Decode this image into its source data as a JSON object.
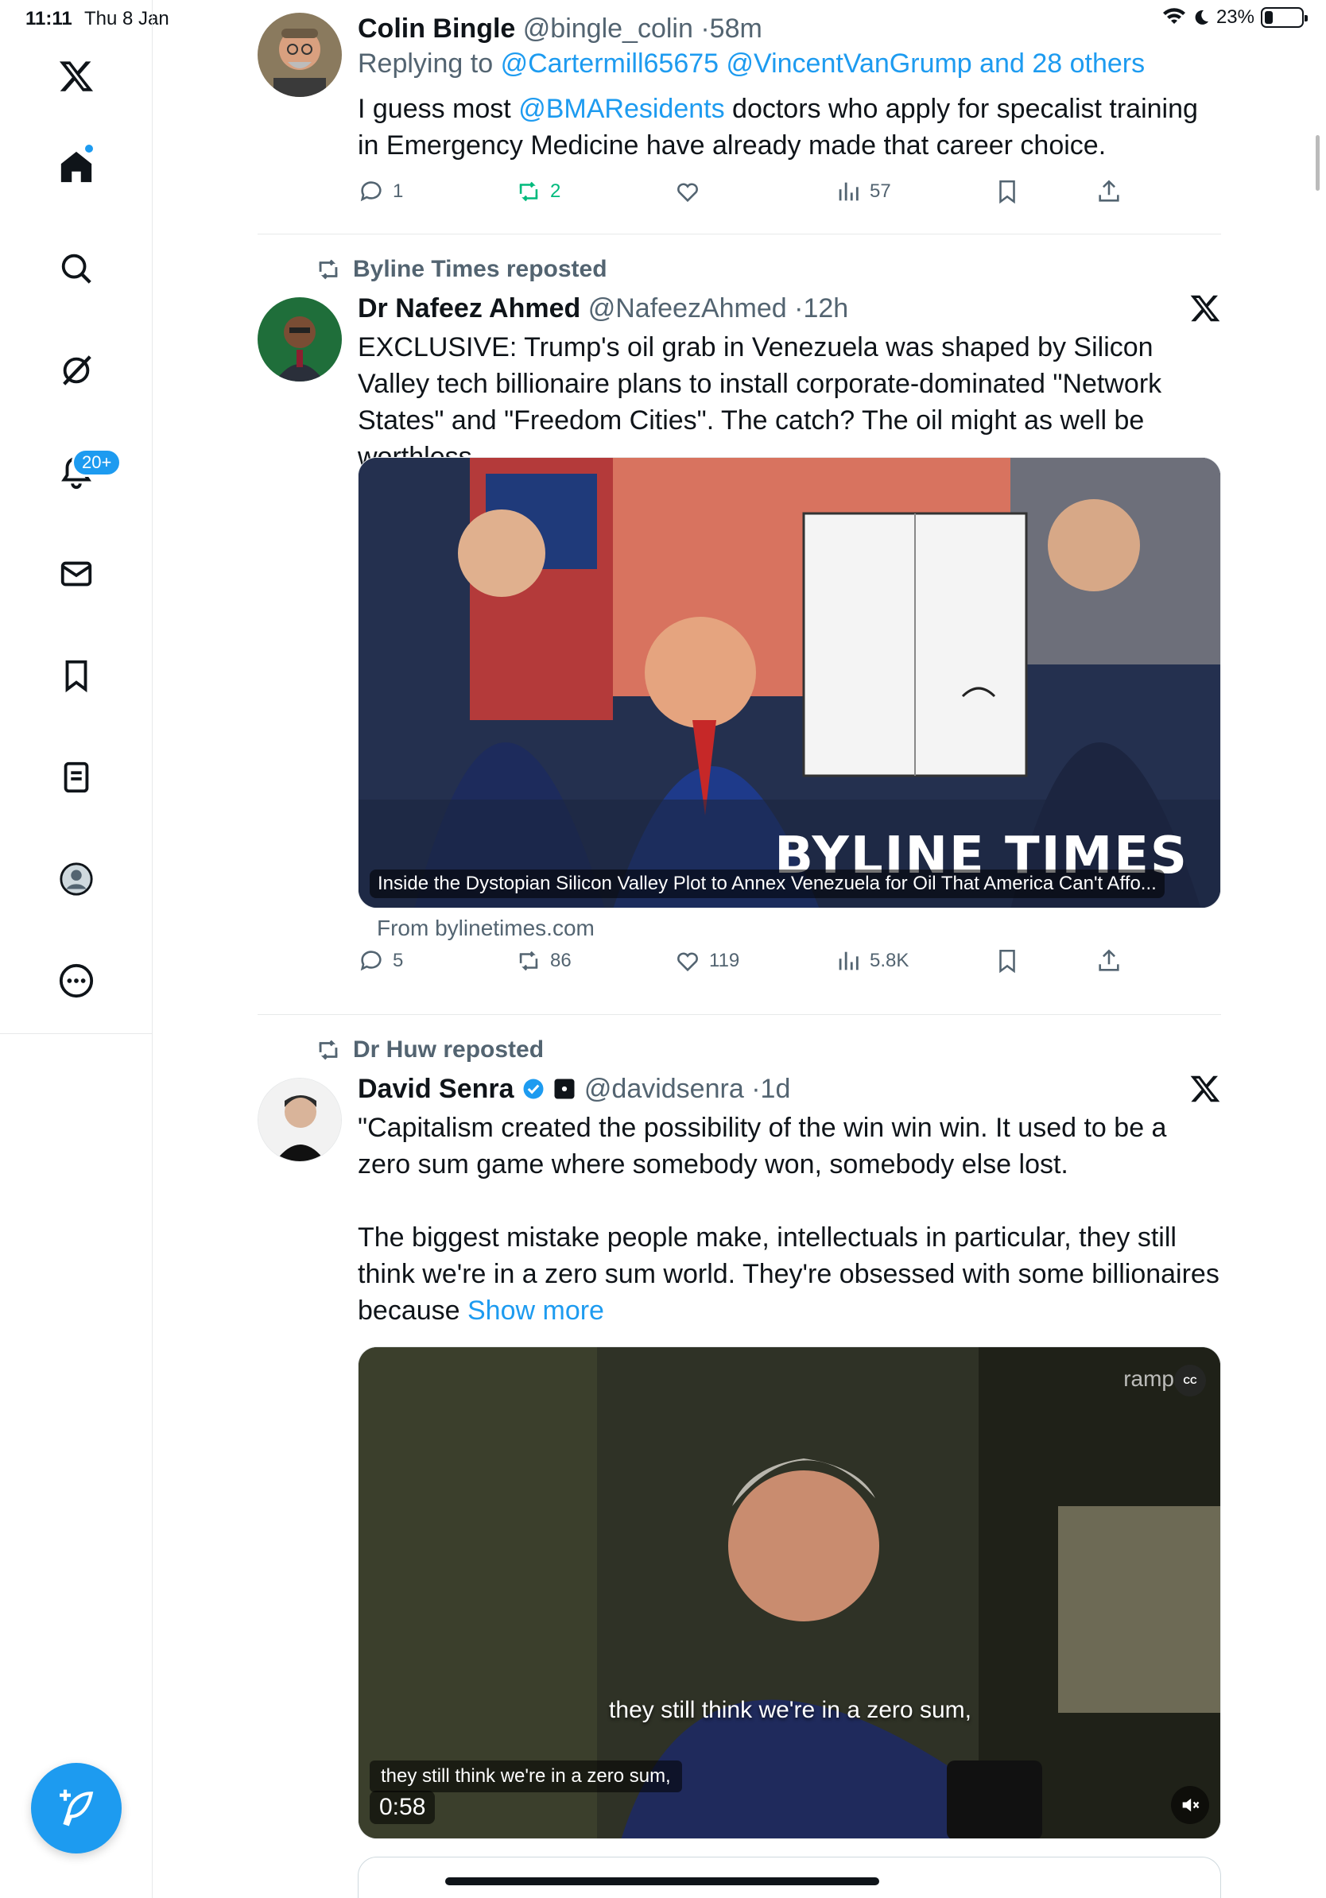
{
  "status_bar": {
    "time": "11:11",
    "date": "Thu 8 Jan",
    "battery": "23%"
  },
  "sidebar": {
    "notifications_badge": "20+"
  },
  "tweets": [
    {
      "name": "Colin Bingle",
      "handle": "@bingle_colin",
      "time": "58m",
      "replying_prefix": "Replying to",
      "replying_to": "@Cartermill65675 @VincentVanGrump and 28 others",
      "text_pre": "I guess most",
      "text_mention": "@BMAResidents",
      "text_post": "doctors who apply for  specalist training in Emergency Medicine have already made that career choice.",
      "replies": "1",
      "reposts": "2",
      "likes": "",
      "views": "57"
    },
    {
      "reposted_by": "Byline Times reposted",
      "name": "Dr Nafeez Ahmed",
      "handle": "@NafeezAhmed",
      "time": "12h",
      "text": "EXCLUSIVE: Trump's oil grab in Venezuela was shaped by Silicon Valley tech billionaire plans to install corporate-dominated \"Network States\" and \"Freedom Cities\". The catch? The oil might as well be worthless.",
      "card_caption": "Inside the Dystopian Silicon Valley Plot to Annex Venezuela for Oil That America Can't Affo...",
      "card_logo": "BYLINE TIMES",
      "card_source": "From bylinetimes.com",
      "replies": "5",
      "reposts": "86",
      "likes": "119",
      "views": "5.8K"
    },
    {
      "reposted_by": "Dr Huw reposted",
      "name": "David Senra",
      "handle": "@davidsenra",
      "time": "1d",
      "text_p1": "\"Capitalism created the possibility of the win win win. It used to be a zero sum game where somebody won, somebody else lost.",
      "text_p2": "The biggest mistake people make, intellectuals in particular, they still think we're in a zero sum world. They're obsessed with some billionaires because",
      "show_more": "Show more",
      "video_caption_burned": "they still think we're in a zero sum,",
      "video_caption_cc": "they still think we're in a zero sum,",
      "video_time": "0:58",
      "video_brand": "ramp",
      "cc_label": "CC"
    }
  ],
  "colors": {
    "accent": "#1d9bf0",
    "repost_green": "#00ba7c",
    "secondary_text": "#536471"
  }
}
